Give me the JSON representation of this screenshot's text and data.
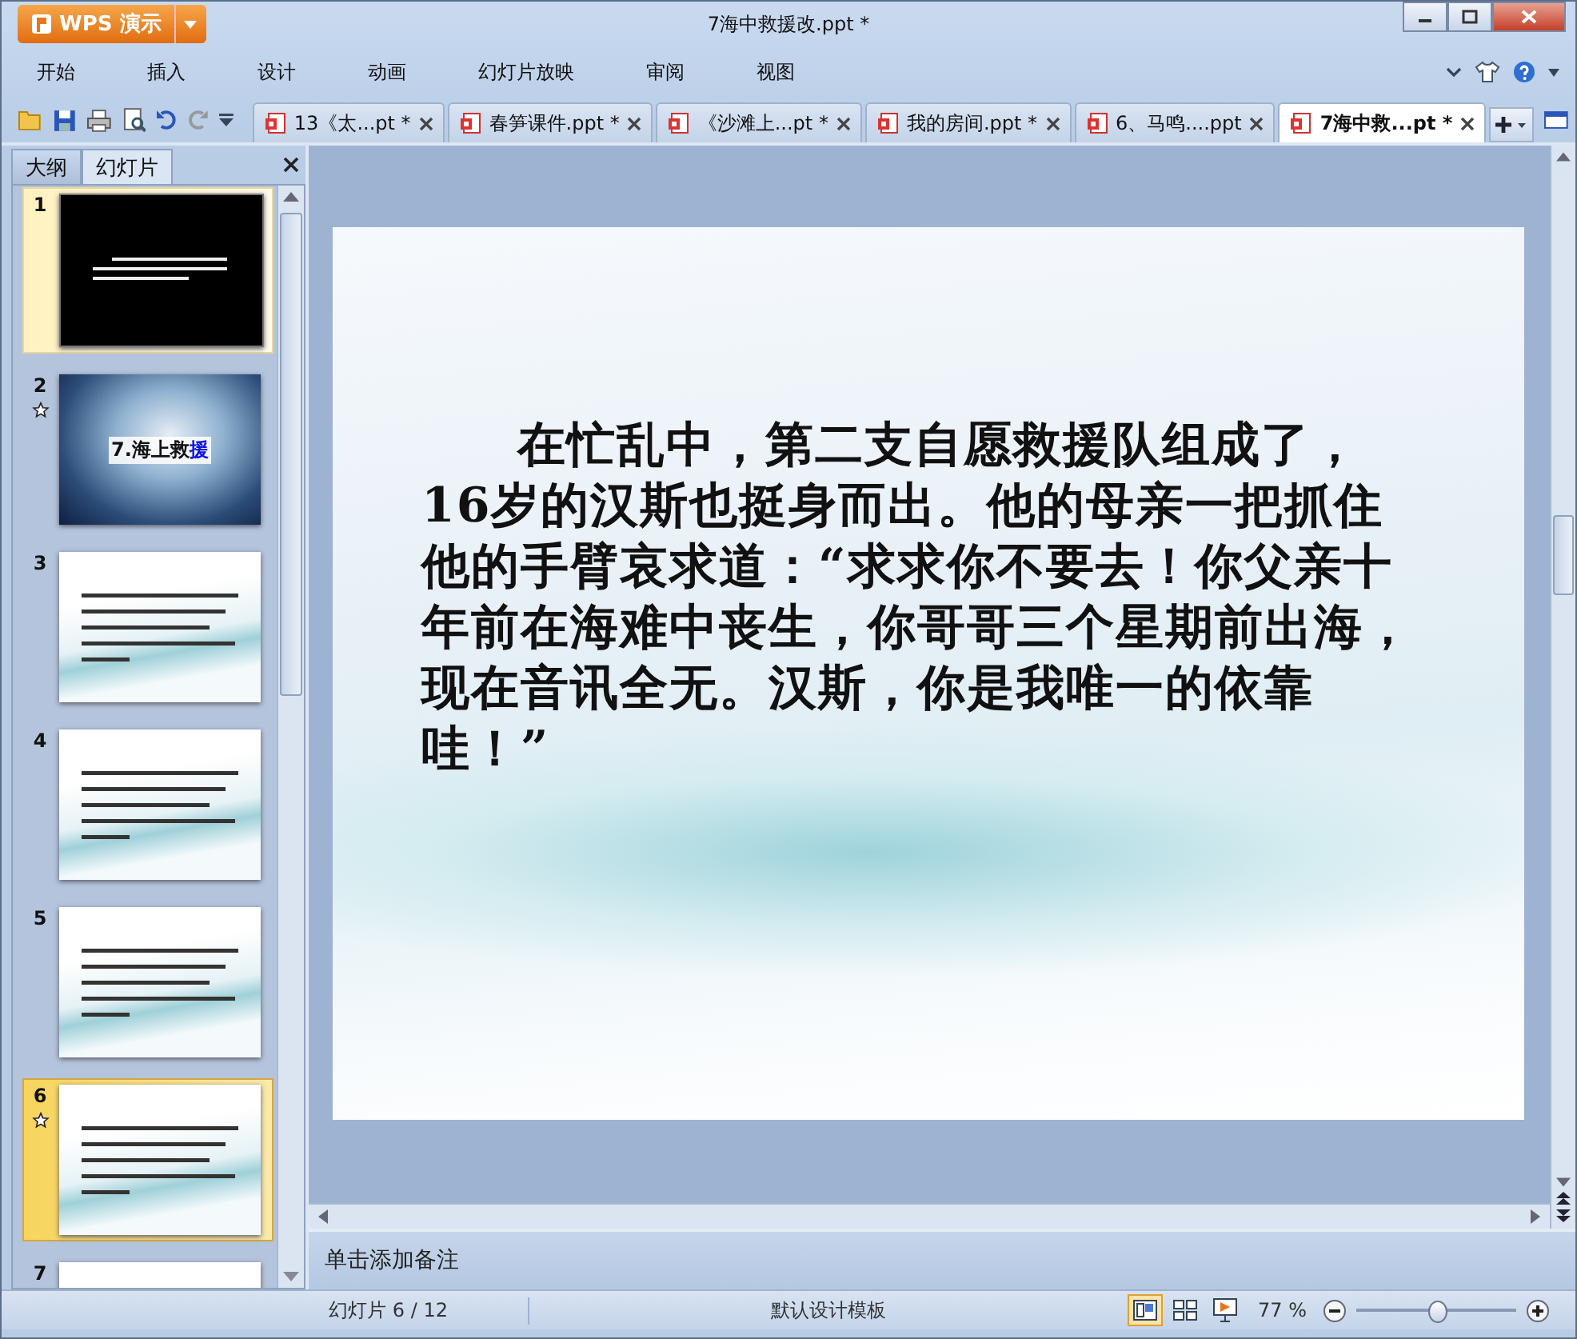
{
  "window": {
    "title": "7海中救援改.ppt *",
    "app_button": "WPS 演示"
  },
  "menu": [
    {
      "label": "开始"
    },
    {
      "label": "插入"
    },
    {
      "label": "设计"
    },
    {
      "label": "动画"
    },
    {
      "label": "幻灯片放映"
    },
    {
      "label": "审阅"
    },
    {
      "label": "视图"
    }
  ],
  "doc_tabs": [
    {
      "label": "13《太...pt *",
      "selected": false
    },
    {
      "label": "春笋课件.ppt *",
      "selected": false
    },
    {
      "label": "《沙滩上...pt *",
      "selected": false
    },
    {
      "label": "我的房间.ppt *",
      "selected": false
    },
    {
      "label": "6、马鸣....ppt",
      "selected": false
    },
    {
      "label": "7海中救...pt *",
      "selected": true
    }
  ],
  "panel_tabs": [
    {
      "label": "大纲",
      "selected": false
    },
    {
      "label": "幻灯片",
      "selected": true
    }
  ],
  "thumbnails": [
    {
      "number": "1",
      "kind": "black",
      "selected": false,
      "highlighted": true,
      "animated": false
    },
    {
      "number": "2",
      "kind": "wave",
      "selected": false,
      "animated": true,
      "title_parts": [
        {
          "text": "7.海上救",
          "highlight": false
        },
        {
          "text": "援",
          "highlight": true
        }
      ]
    },
    {
      "number": "3",
      "kind": "sky",
      "selected": false,
      "animated": false
    },
    {
      "number": "4",
      "kind": "sky",
      "selected": false,
      "animated": false
    },
    {
      "number": "5",
      "kind": "sky",
      "selected": false,
      "animated": false
    },
    {
      "number": "6",
      "kind": "sky",
      "selected": true,
      "animated": true
    },
    {
      "number": "7",
      "kind": "sky",
      "selected": false,
      "animated": false
    }
  ],
  "slide": {
    "paragraph": "在忙乱中，第二支自愿救援队组成了，16岁的汉斯也挺身而出。他的母亲一把抓住他的手臂哀求道：“求求你不要去！你父亲十年前在海难中丧生，你哥哥三个星期前出海，现在音讯全无。汉斯，你是我唯一的依靠哇！”"
  },
  "notes": {
    "placeholder": "单击添加备注"
  },
  "status_bar": {
    "slide_counter": "幻灯片 6 / 12",
    "template": "默认设计模板",
    "views": [
      {
        "kind": "normal",
        "selected": true
      },
      {
        "kind": "sorter",
        "selected": false
      },
      {
        "kind": "show",
        "selected": false
      }
    ],
    "zoom": "77 %",
    "zoom_slider": {
      "level": 0.5
    }
  }
}
